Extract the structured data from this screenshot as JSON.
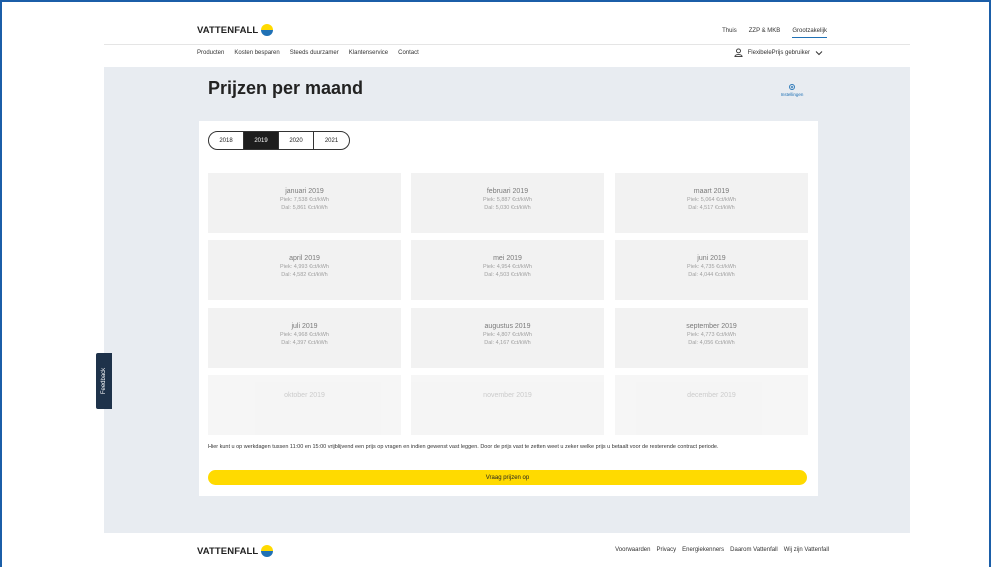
{
  "brand": {
    "name": "VATTENFALL"
  },
  "segments": [
    {
      "label": "Thuis",
      "active": false
    },
    {
      "label": "ZZP & MKB",
      "active": false
    },
    {
      "label": "Grootzakelijk",
      "active": true
    }
  ],
  "nav": {
    "links": [
      "Producten",
      "Kosten besparen",
      "Steeds duurzamer",
      "Klantenservice",
      "Contact"
    ],
    "user_label": "FlexibelePrijs gebruiker"
  },
  "page": {
    "title": "Prijzen per maand",
    "settings_label": "Instellingen"
  },
  "years": {
    "tabs": [
      "2018",
      "2019",
      "2020",
      "2021"
    ],
    "selected": "2019"
  },
  "months": [
    {
      "name": "januari 2019",
      "piek": "Piek: 7,538 €ct/kWh",
      "dal": "Dal: 5,861 €ct/kWh"
    },
    {
      "name": "februari 2019",
      "piek": "Piek: 5,887 €ct/kWh",
      "dal": "Dal: 5,030 €ct/kWh"
    },
    {
      "name": "maart 2019",
      "piek": "Piek: 5,064 €ct/kWh",
      "dal": "Dal: 4,517 €ct/kWh"
    },
    {
      "name": "april 2019",
      "piek": "Piek: 4,993 €ct/kWh",
      "dal": "Dal: 4,582 €ct/kWh"
    },
    {
      "name": "mei 2019",
      "piek": "Piek: 4,954 €ct/kWh",
      "dal": "Dal: 4,503 €ct/kWh"
    },
    {
      "name": "juni 2019",
      "piek": "Piek: 4,735 €ct/kWh",
      "dal": "Dal: 4,044 €ct/kWh"
    },
    {
      "name": "juli 2019",
      "piek": "Piek: 4,968 €ct/kWh",
      "dal": "Dal: 4,397 €ct/kWh"
    },
    {
      "name": "augustus 2019",
      "piek": "Piek: 4,807 €ct/kWh",
      "dal": "Dal: 4,167 €ct/kWh"
    },
    {
      "name": "september 2019",
      "piek": "Piek: 4,773 €ct/kWh",
      "dal": "Dal: 4,056 €ct/kWh"
    },
    {
      "name": "oktober 2019",
      "piek": "",
      "dal": ""
    },
    {
      "name": "november 2019",
      "piek": "",
      "dal": ""
    },
    {
      "name": "december 2019",
      "piek": "",
      "dal": ""
    }
  ],
  "note": "Hier kunt u op werkdagen tussen 11:00 en 15:00 vrijblijvend een prijs op vragen en indien gewenst vast leggen. Door de prijs vast te zetten weet u zeker welke prijs u betaalt voor de resterende contract periode.",
  "cta_label": "Vraag prijzen op",
  "feedback_label": "Feedback",
  "footer": {
    "links": [
      "Voorwaarden",
      "Privacy",
      "Energiekenners",
      "Daarom Vattenfall",
      "Wij zijn Vattenfall"
    ]
  },
  "colors": {
    "brand_yellow": "#ffda00",
    "brand_blue": "#2071b5",
    "page_bg": "#e8ecf1"
  }
}
